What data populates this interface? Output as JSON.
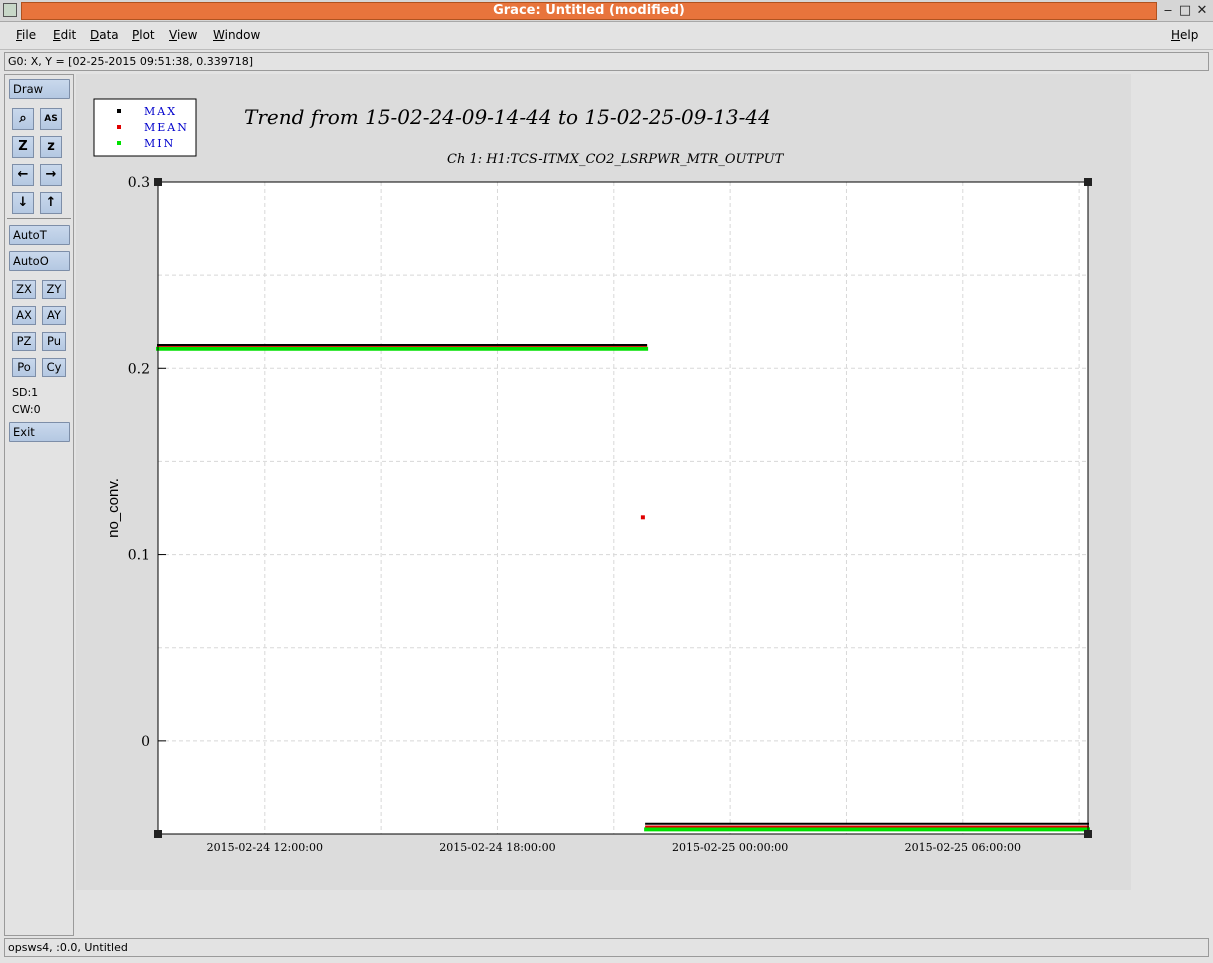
{
  "window": {
    "title": "Grace: Untitled (modified)",
    "controls": {
      "minimize": "‒",
      "maximize": "□",
      "close": "✕"
    }
  },
  "menu": {
    "file": "File",
    "edit": "Edit",
    "data": "Data",
    "plot": "Plot",
    "view": "View",
    "window": "Window",
    "help": "Help"
  },
  "locator": "G0: X, Y = [02-25-2015 09:51:38, 0.339718]",
  "toolbar": {
    "draw": "Draw",
    "zoom_glyph": "⌕",
    "autoscale_glyph": "AS",
    "zoom_in_glyph": "Z",
    "zoom_out_glyph": "z",
    "arrow_left": "←",
    "arrow_right": "→",
    "arrow_down": "↓",
    "arrow_up": "↑",
    "autot": "AutoT",
    "autoo": "AutoO",
    "zx": "ZX",
    "zy": "ZY",
    "ax": "AX",
    "ay": "AY",
    "pz": "PZ",
    "pu": "Pu",
    "po": "Po",
    "cy": "Cy",
    "sd": "SD:1",
    "cw": "CW:0",
    "exit": "Exit"
  },
  "status": "opsws4, :0.0, Untitled",
  "colors": {
    "titlebar_accent": "#e8743c",
    "max": "#000000",
    "mean": "#e00000",
    "min": "#00e000",
    "legend_text": "#0000cc"
  },
  "chart_data": {
    "type": "scatter",
    "title": "Trend from 15-02-24-09-14-44 to 15-02-25-09-13-44",
    "subtitle": "Ch 1: H1:TCS-ITMX_CO2_LSRPWR_MTR_OUTPUT",
    "xlabel": "",
    "ylabel": "no_conv.",
    "xlim": [
      "2015-02-24 09:14:44",
      "2015-02-25 09:13:44"
    ],
    "ylim": [
      -0.05,
      0.3
    ],
    "yticks": [
      0,
      0.1,
      0.2,
      0.3
    ],
    "ytick_labels": [
      "0",
      "0.1",
      "0.2",
      "0.3"
    ],
    "xticks": [
      "2015-02-24 12:00:00",
      "2015-02-24 18:00:00",
      "2015-02-25 00:00:00",
      "2015-02-25 06:00:00"
    ],
    "grid": true,
    "legend_position": "top-left",
    "series": [
      {
        "name": "MAX",
        "color": "#000000",
        "segments": [
          {
            "x_start": "2015-02-24 09:14:44",
            "x_end": "2015-02-24 21:50:00",
            "y": 0.2125
          },
          {
            "x_start": "2015-02-24 21:50:00",
            "x_end": "2015-02-25 09:13:44",
            "y": -0.0445
          }
        ]
      },
      {
        "name": "MEAN",
        "color": "#e00000",
        "segments": [
          {
            "x_start": "2015-02-24 09:14:44",
            "x_end": "2015-02-24 21:50:00",
            "y": 0.212
          },
          {
            "x_start": "2015-02-24 21:50:00",
            "x_end": "2015-02-25 09:13:44",
            "y": -0.046
          }
        ],
        "points": [
          {
            "x": "2015-02-24 21:45:00",
            "y": 0.12
          }
        ]
      },
      {
        "name": "MIN",
        "color": "#00e000",
        "segments": [
          {
            "x_start": "2015-02-24 09:14:44",
            "x_end": "2015-02-24 21:50:00",
            "y": 0.2105
          },
          {
            "x_start": "2015-02-24 21:50:00",
            "x_end": "2015-02-25 09:13:44",
            "y": -0.0475
          }
        ]
      }
    ]
  }
}
